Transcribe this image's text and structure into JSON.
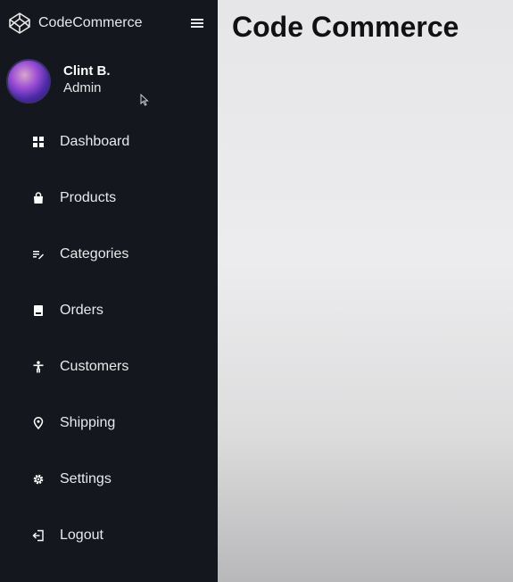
{
  "brand": {
    "name": "CodeCommerce",
    "icon": "codepen-cube-icon"
  },
  "header": {
    "menu_icon": "hamburger-icon"
  },
  "profile": {
    "name": "Clint B.",
    "role": "Admin"
  },
  "nav": {
    "items": [
      {
        "label": "Dashboard",
        "icon": "grid-icon"
      },
      {
        "label": "Products",
        "icon": "bag-icon"
      },
      {
        "label": "Categories",
        "icon": "list-edit-icon"
      },
      {
        "label": "Orders",
        "icon": "book-icon"
      },
      {
        "label": "Customers",
        "icon": "person-icon"
      },
      {
        "label": "Shipping",
        "icon": "location-pin-icon"
      },
      {
        "label": "Settings",
        "icon": "gear-icon"
      },
      {
        "label": "Logout",
        "icon": "logout-icon"
      }
    ]
  },
  "main": {
    "title": "Code Commerce"
  },
  "colors": {
    "sidebar_bg": "#14171d",
    "main_bg": "#ececee",
    "text_light": "#e9e9ec",
    "title_text": "#111111"
  }
}
